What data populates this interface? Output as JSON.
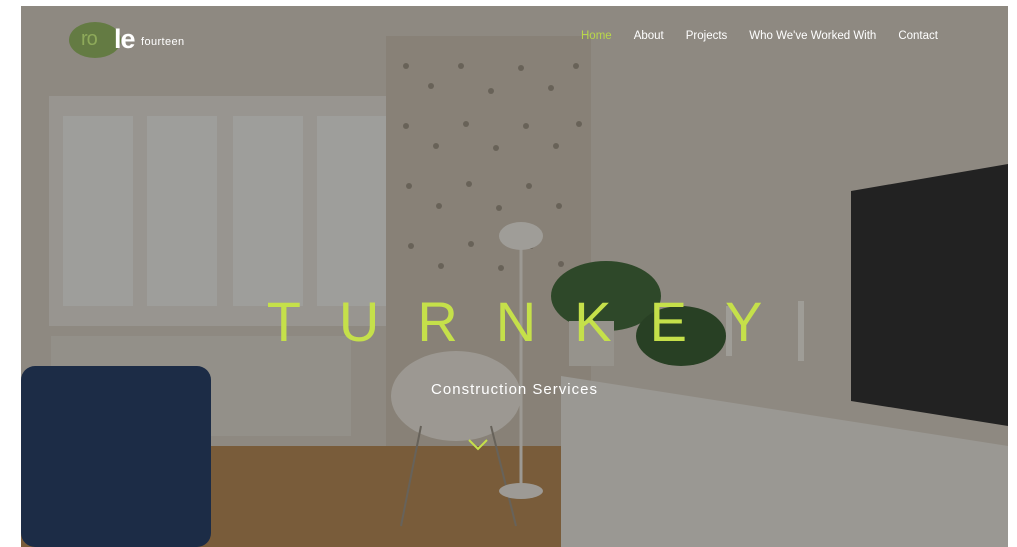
{
  "brand": {
    "ro": "ro",
    "le": "le",
    "suffix": "fourteen"
  },
  "nav": {
    "items": [
      "Home",
      "About",
      "Projects",
      "Who We've Worked With",
      "Contact"
    ],
    "active_index": 0
  },
  "hero": {
    "headline": "TURNKEY",
    "subtitle": "Construction Services"
  },
  "colors": {
    "accent": "#b9d84a",
    "headline": "#c5e04a",
    "logo_green": "#5f7a3c"
  },
  "icons": {
    "scroll": "chevron-down-icon"
  }
}
